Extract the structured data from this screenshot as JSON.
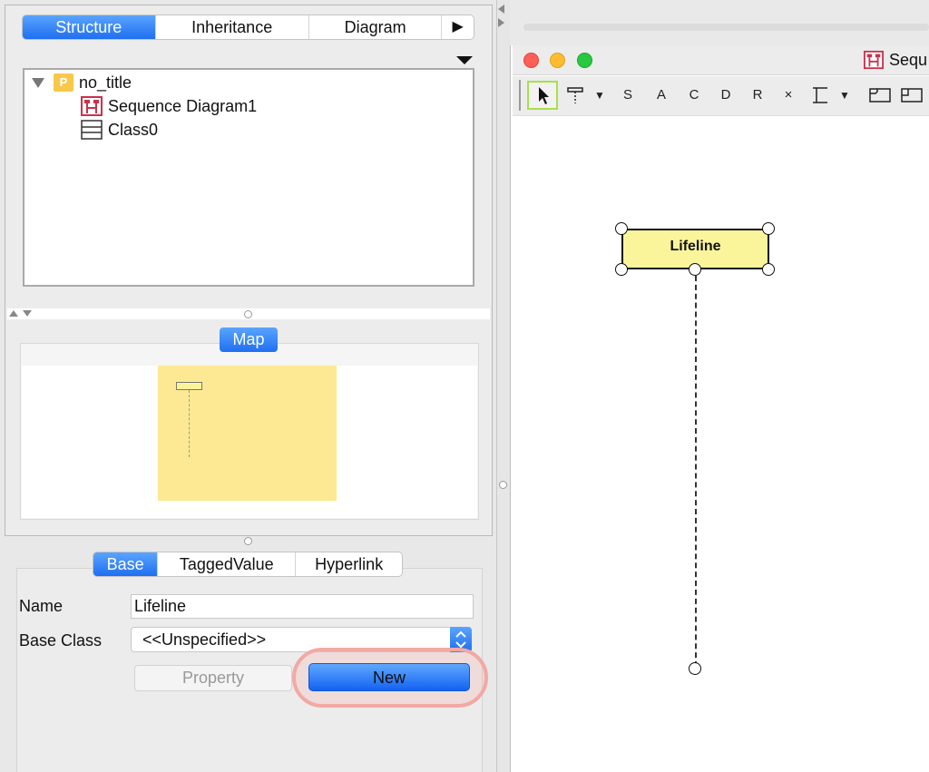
{
  "left": {
    "tabs": [
      "Structure",
      "Inheritance",
      "Diagram"
    ],
    "tabs_more": "▶",
    "tree": {
      "root": "no_title",
      "root_badge": "P",
      "children": [
        "Sequence Diagram1",
        "Class0"
      ]
    },
    "map_label": "Map",
    "props": {
      "tabs": [
        "Base",
        "TaggedValue",
        "Hyperlink"
      ],
      "name_label": "Name",
      "name_value": "Lifeline",
      "base_class_label": "Base Class",
      "base_class_value": "<<Unspecified>>",
      "property_button": "Property",
      "new_button": "New"
    }
  },
  "right": {
    "window_title": "Sequ",
    "toolbar_items": [
      "S",
      "A",
      "C",
      "D",
      "R",
      "×"
    ],
    "lifeline_label": "Lifeline"
  },
  "colors": {
    "accent_blue": "#1f6ff0",
    "lifeline_fill": "#faf59b",
    "highlight_ring": "#f2a9a3",
    "diagram_icon": "#c8324d"
  }
}
